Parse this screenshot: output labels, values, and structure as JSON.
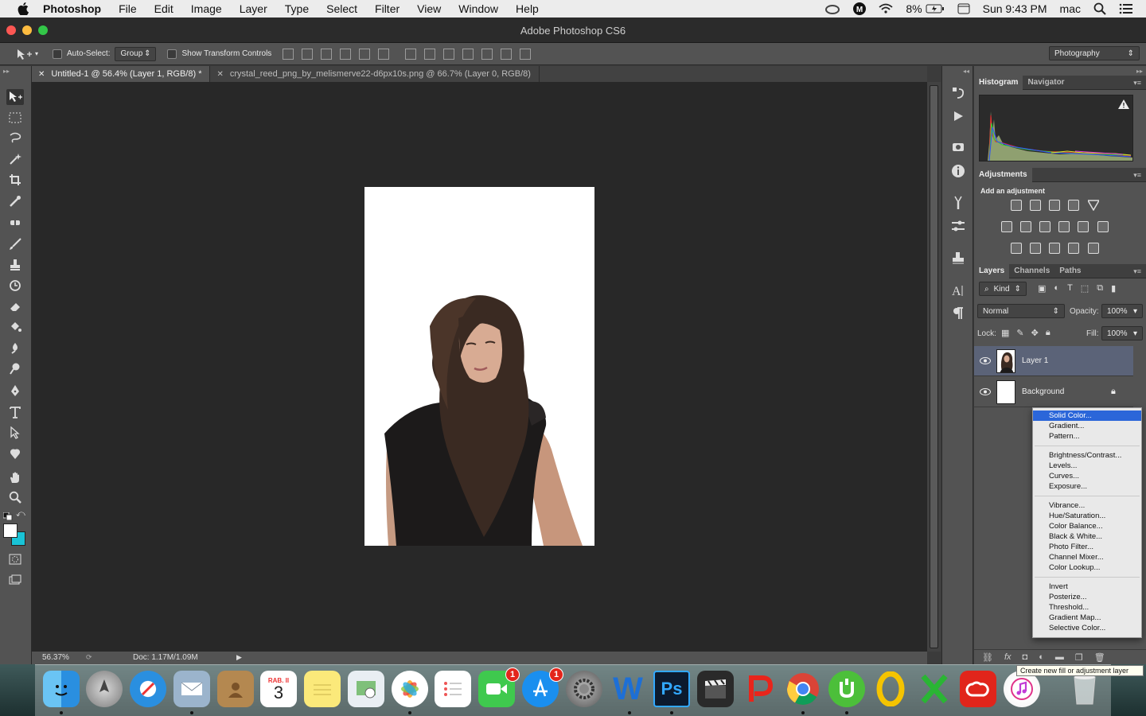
{
  "menubar": {
    "app_name": "Photoshop",
    "items": [
      "File",
      "Edit",
      "Image",
      "Layer",
      "Type",
      "Select",
      "Filter",
      "View",
      "Window",
      "Help"
    ],
    "battery": "8%",
    "clock": "Sun 9:43 PM",
    "user": "mac"
  },
  "window": {
    "title": "Adobe Photoshop CS6"
  },
  "options": {
    "auto_select_label": "Auto-Select:",
    "auto_select_value": "Group",
    "transform_label": "Show Transform Controls",
    "workspace": "Photography"
  },
  "tabs": [
    {
      "label": "Untitled-1 @ 56.4% (Layer 1, RGB/8) *"
    },
    {
      "label": "crystal_reed_png_by_melismerve22-d6px10s.png @ 66.7% (Layer 0, RGB/8)"
    }
  ],
  "status": {
    "zoom": "56.37%",
    "doc": "Doc: 1.17M/1.09M"
  },
  "panels": {
    "histogram_tab": "Histogram",
    "navigator_tab": "Navigator",
    "adjustments_tab": "Adjustments",
    "add_adjustment": "Add an adjustment",
    "layers_tab": "Layers",
    "channels_tab": "Channels",
    "paths_tab": "Paths",
    "kind": "Kind",
    "blend_mode": "Normal",
    "opacity_label": "Opacity:",
    "opacity_value": "100%",
    "lock_label": "Lock:",
    "fill_label": "Fill:",
    "fill_value": "100%",
    "layers": [
      {
        "name": "Layer 1"
      },
      {
        "name": "Background"
      }
    ]
  },
  "adj_menu": {
    "group1": [
      "Solid Color...",
      "Gradient...",
      "Pattern..."
    ],
    "group2": [
      "Brightness/Contrast...",
      "Levels...",
      "Curves...",
      "Exposure..."
    ],
    "group3": [
      "Vibrance...",
      "Hue/Saturation...",
      "Color Balance...",
      "Black & White...",
      "Photo Filter...",
      "Channel Mixer...",
      "Color Lookup..."
    ],
    "group4": [
      "Invert",
      "Posterize...",
      "Threshold...",
      "Gradient Map...",
      "Selective Color..."
    ]
  },
  "tooltip": "Create new fill or adjustment layer",
  "dock": {
    "calendar_month": "RAB. II",
    "calendar_day": "3",
    "facetime_badge": "1",
    "appstore_badge": "1",
    "ps_label": "Ps",
    "word_label": "W"
  },
  "colors": {
    "highlight": "#2b66d9",
    "selected_layer": "#5b6378",
    "panel_bg": "#535353",
    "canvas_bg": "#282828"
  }
}
